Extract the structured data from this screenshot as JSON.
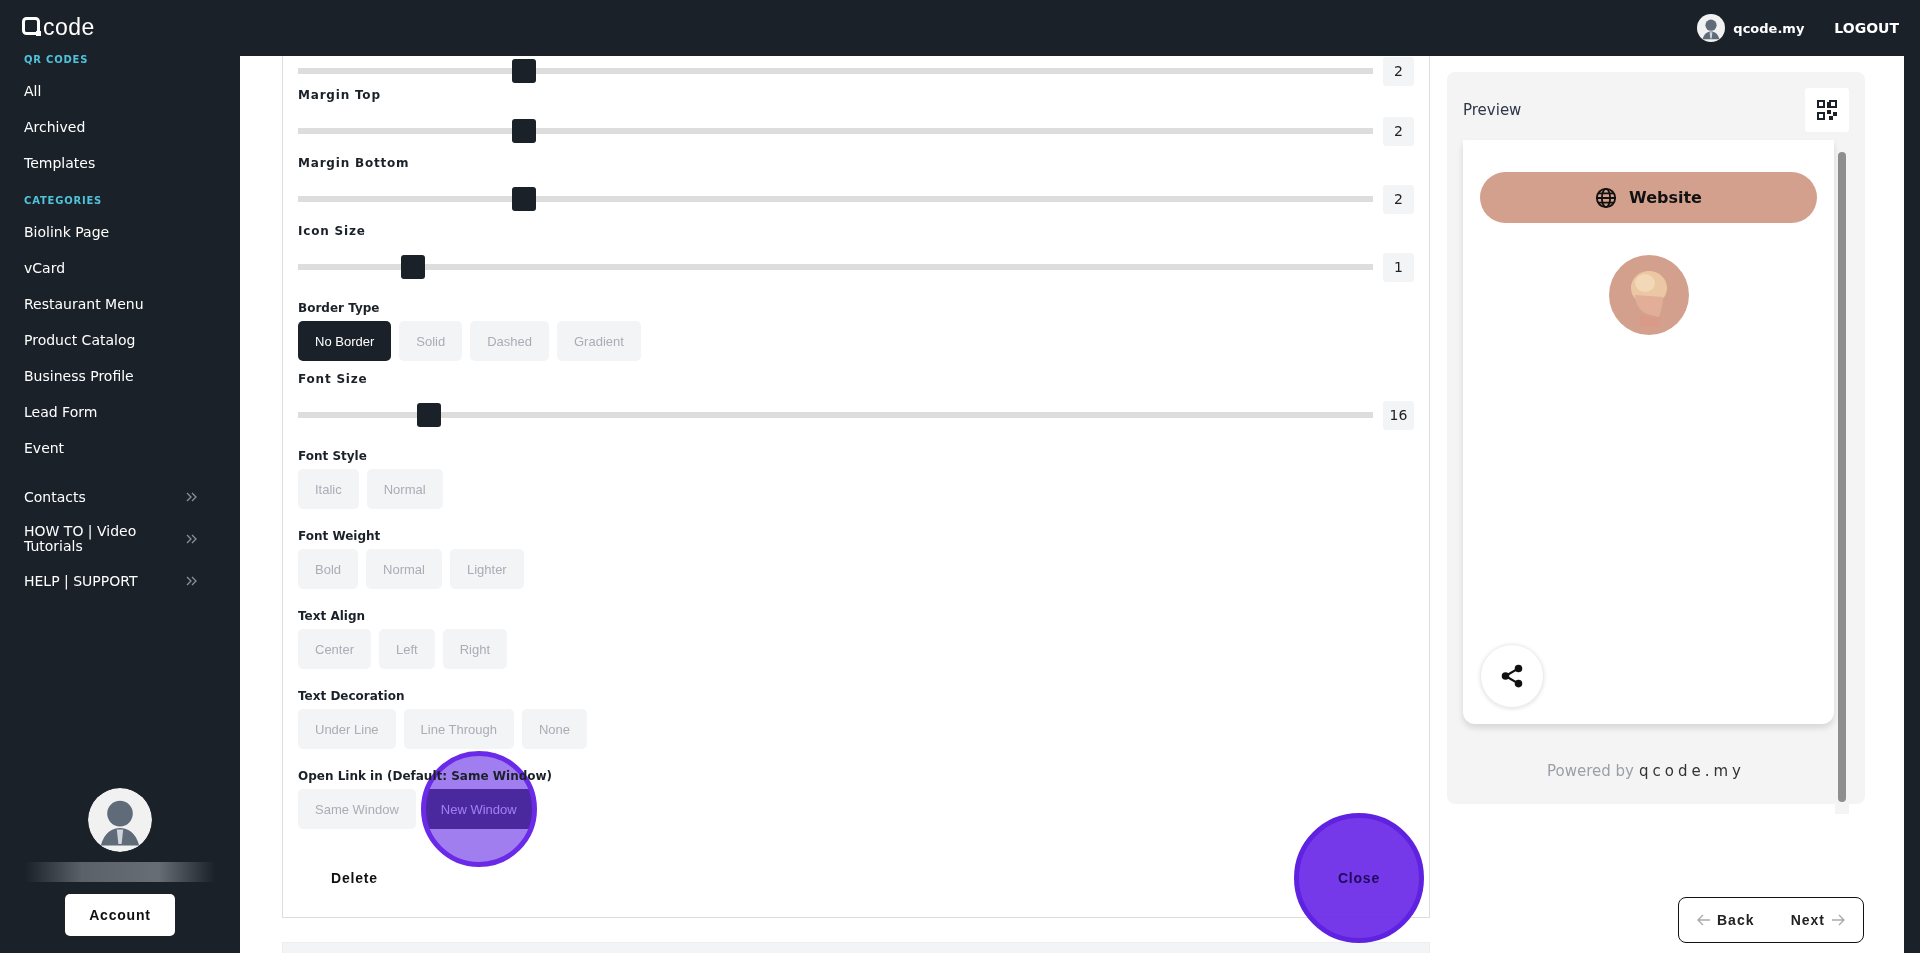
{
  "header": {
    "logo_text": "code",
    "username": "qcode.my",
    "logout": "LOGOUT"
  },
  "sidebar": {
    "sections": [
      {
        "title": "QR CODES",
        "items": [
          {
            "label": "All",
            "submenu": false
          },
          {
            "label": "Archived",
            "submenu": false
          },
          {
            "label": "Templates",
            "submenu": false
          }
        ]
      },
      {
        "title": "CATEGORIES",
        "items": [
          {
            "label": "Biolink Page",
            "submenu": false
          },
          {
            "label": "vCard",
            "submenu": false
          },
          {
            "label": "Restaurant Menu",
            "submenu": false
          },
          {
            "label": "Product Catalog",
            "submenu": false
          },
          {
            "label": "Business Profile",
            "submenu": false
          },
          {
            "label": "Lead Form",
            "submenu": false
          },
          {
            "label": "Event",
            "submenu": false
          }
        ]
      },
      {
        "items": [
          {
            "label": "Contacts",
            "submenu": true
          },
          {
            "label": "HOW TO | Video Tutorials",
            "submenu": true
          },
          {
            "label": "HELP | SUPPORT",
            "submenu": true
          }
        ]
      }
    ],
    "account_button": "Account"
  },
  "form": {
    "fields": [
      {
        "kind": "slider",
        "level": 0.21,
        "value": "2"
      },
      {
        "kind": "slider",
        "label": "Margin Top",
        "level": 0.21,
        "value": "2"
      },
      {
        "kind": "slider",
        "label": "Margin Bottom",
        "level": 0.21,
        "value": "2"
      },
      {
        "kind": "slider",
        "label": "Icon Size",
        "level": 0.107,
        "value": "1"
      },
      {
        "kind": "options",
        "label": "Border Type",
        "options": [
          {
            "label": "No Border",
            "selected": true,
            "highlighted": false
          },
          {
            "label": "Solid",
            "selected": false,
            "highlighted": false
          },
          {
            "label": "Dashed",
            "selected": false,
            "highlighted": false
          },
          {
            "label": "Gradient",
            "selected": false,
            "highlighted": false
          }
        ]
      },
      {
        "kind": "slider",
        "label": "Font Size",
        "level": 0.122,
        "value": "16"
      },
      {
        "kind": "options",
        "label": "Font Style",
        "options": [
          {
            "label": "Italic",
            "selected": false,
            "highlighted": false
          },
          {
            "label": "Normal",
            "selected": false,
            "highlighted": false
          }
        ]
      },
      {
        "kind": "options",
        "label": "Font Weight",
        "options": [
          {
            "label": "Bold",
            "selected": false,
            "highlighted": false
          },
          {
            "label": "Normal",
            "selected": false,
            "highlighted": false
          },
          {
            "label": "Lighter",
            "selected": false,
            "highlighted": false
          }
        ]
      },
      {
        "kind": "options",
        "label": "Text Align",
        "options": [
          {
            "label": "Center",
            "selected": false,
            "highlighted": false
          },
          {
            "label": "Left",
            "selected": false,
            "highlighted": false
          },
          {
            "label": "Right",
            "selected": false,
            "highlighted": false
          }
        ]
      },
      {
        "kind": "options",
        "label": "Text Decoration",
        "options": [
          {
            "label": "Under Line",
            "selected": false,
            "highlighted": false
          },
          {
            "label": "Line Through",
            "selected": false,
            "highlighted": false
          },
          {
            "label": "None",
            "selected": false,
            "highlighted": false
          }
        ]
      },
      {
        "kind": "options",
        "label": "Open Link in (Default: Same Window)",
        "options": [
          {
            "label": "Same Window",
            "selected": false,
            "highlighted": false
          },
          {
            "label": "New Window",
            "selected": true,
            "highlighted": true
          }
        ]
      }
    ],
    "delete_button": "Delete",
    "close_button": {
      "label": "Close",
      "highlighted": true
    }
  },
  "preview": {
    "title": "Preview",
    "website_button": "Website",
    "powered_by": "Powered by",
    "brand": "qcode.my"
  },
  "nav": {
    "back": "Back",
    "next": "Next"
  }
}
